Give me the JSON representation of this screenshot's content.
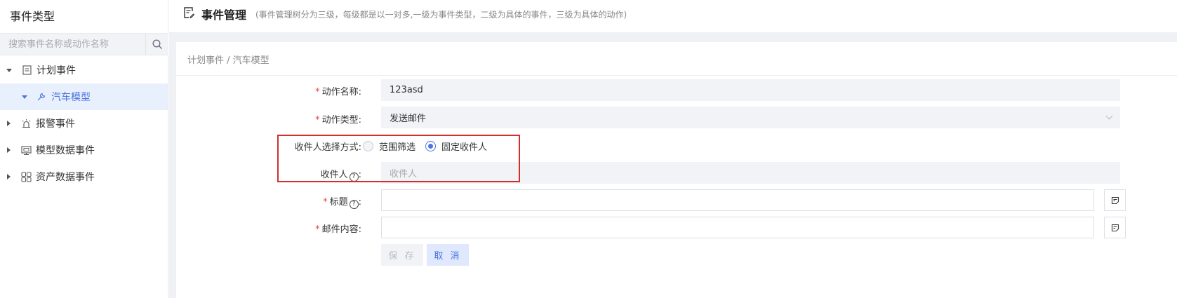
{
  "sidebar": {
    "title": "事件类型",
    "search_placeholder": "搜索事件名称或动作名称",
    "items": [
      {
        "label": "计划事件",
        "icon": "document-icon",
        "expanded": true
      },
      {
        "label": "汽车模型",
        "icon": "wrench-icon",
        "selected": true,
        "child": true
      },
      {
        "label": "报警事件",
        "icon": "alarm-icon"
      },
      {
        "label": "模型数据事件",
        "icon": "monitor-icon"
      },
      {
        "label": "资产数据事件",
        "icon": "grid-icon"
      }
    ]
  },
  "header": {
    "icon": "edit-document-icon",
    "title": "事件管理",
    "description": "(事件管理树分为三级，每级都是以一对多,一级为事件类型，二级为具体的事件，三级为具体的动作)"
  },
  "breadcrumb": "计划事件 / 汽车模型",
  "form": {
    "action_name_label": "动作名称:",
    "action_name_value": "123asd",
    "action_type_label": "动作类型:",
    "action_type_value": "发送邮件",
    "recipient_mode_label": "收件人选择方式:",
    "recipient_mode_options": [
      "范围筛选",
      "固定收件人"
    ],
    "recipient_mode_selected": "固定收件人",
    "recipient_label": "收件人",
    "recipient_placeholder": "收件人",
    "title_label": "标题",
    "title_value": "",
    "mail_content_label": "邮件内容:",
    "mail_content_value": "",
    "save_label": "保 存",
    "cancel_label": "取 消",
    "colon": ":",
    "required_mark": "*",
    "help_mark": "?"
  },
  "colors": {
    "accent": "#4a76e0",
    "required": "#e64545",
    "highlight": "#d12f2f",
    "selected_bg": "#e8effd"
  }
}
